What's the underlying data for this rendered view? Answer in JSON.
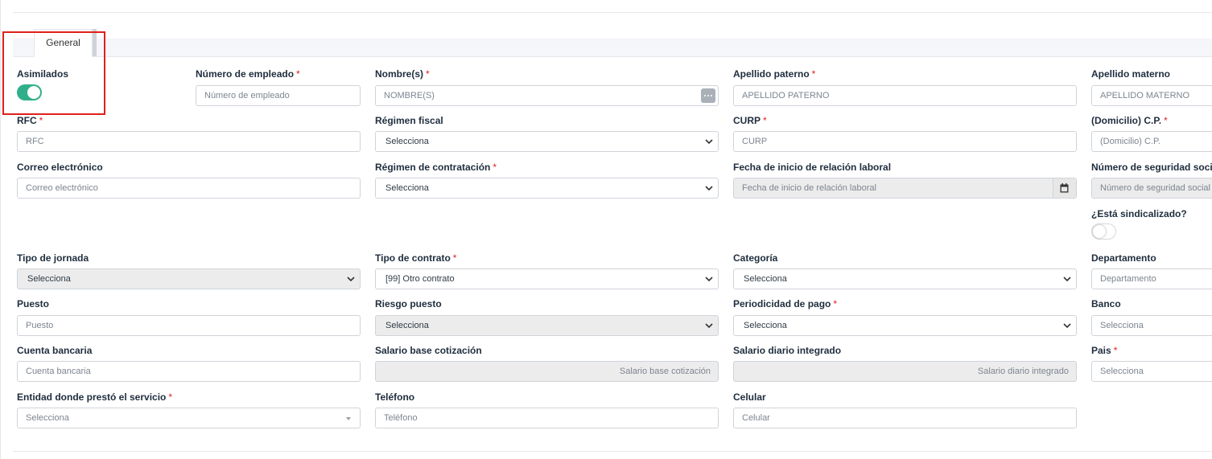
{
  "tabs": [
    {
      "label": "General"
    }
  ],
  "colors": {
    "accent": "#2fb08b",
    "required": "#e0201b",
    "highlight": "#e0201b"
  },
  "form": {
    "asimilados": {
      "label": "Asimilados",
      "on": true
    },
    "numero_empleado": {
      "label": "Número de empleado",
      "placeholder": "Número de empleado"
    },
    "nombre": {
      "label": "Nombre(s)",
      "placeholder": "NOMBRE(S)",
      "icon": "more-dots-icon"
    },
    "apellido_paterno": {
      "label": "Apellido paterno",
      "placeholder": "APELLIDO PATERNO"
    },
    "apellido_materno": {
      "label": "Apellido materno",
      "placeholder": "APELLIDO MATERNO"
    },
    "rfc": {
      "label": "RFC",
      "placeholder": "RFC"
    },
    "regimen_fiscal": {
      "label": "Régimen fiscal",
      "value": "Selecciona"
    },
    "curp": {
      "label": "CURP",
      "placeholder": "CURP"
    },
    "domicilio_cp": {
      "label": "(Domicilio) C.P.",
      "placeholder": "(Domicilio) C.P."
    },
    "correo": {
      "label": "Correo electrónico",
      "placeholder": "Correo electrónico"
    },
    "regimen_contratacion": {
      "label": "Régimen de contratación",
      "value": "Selecciona"
    },
    "fecha_inicio": {
      "label": "Fecha de inicio de relación laboral",
      "placeholder": "Fecha de inicio de relación laboral",
      "icon": "calendar-icon"
    },
    "nss": {
      "label": "Número de seguridad social",
      "placeholder": "Número de seguridad social"
    },
    "sindicalizado": {
      "label": "¿Está sindicalizado?",
      "on": false
    },
    "tipo_jornada": {
      "label": "Tipo de jornada",
      "value": "Selecciona"
    },
    "tipo_contrato": {
      "label": "Tipo de contrato",
      "value": "[99] Otro contrato"
    },
    "categoria": {
      "label": "Categoría",
      "value": "Selecciona"
    },
    "departamento": {
      "label": "Departamento",
      "placeholder": "Departamento"
    },
    "puesto": {
      "label": "Puesto",
      "placeholder": "Puesto"
    },
    "riesgo_puesto": {
      "label": "Riesgo puesto",
      "value": "Selecciona"
    },
    "periodicidad_pago": {
      "label": "Periodicidad de pago",
      "value": "Selecciona"
    },
    "banco": {
      "label": "Banco",
      "placeholder": "Selecciona"
    },
    "cuenta_bancaria": {
      "label": "Cuenta bancaria",
      "placeholder": "Cuenta bancaria"
    },
    "salario_base": {
      "label": "Salario base cotización",
      "placeholder": "Salario base cotización"
    },
    "salario_diario": {
      "label": "Salario diario integrado",
      "placeholder": "Salario diario integrado"
    },
    "pais": {
      "label": "Pais",
      "placeholder": "Selecciona"
    },
    "entidad": {
      "label": "Entidad donde prestó el servicio",
      "placeholder": "Selecciona"
    },
    "telefono": {
      "label": "Teléfono",
      "placeholder": "Teléfono"
    },
    "celular": {
      "label": "Celular",
      "placeholder": "Celular"
    }
  }
}
